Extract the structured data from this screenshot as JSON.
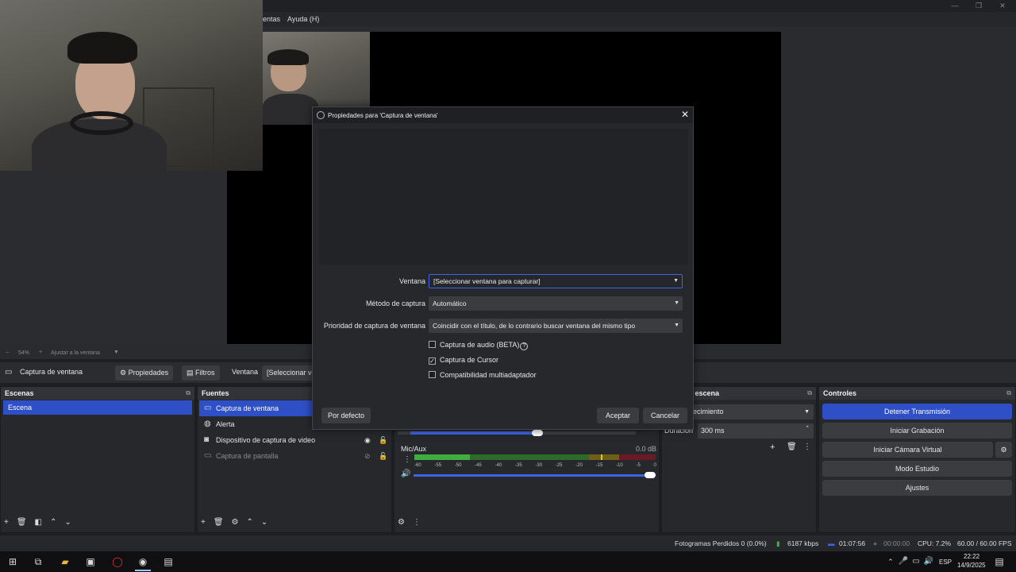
{
  "menu": {
    "partial_item": "entas",
    "help": "Ayuda (H)"
  },
  "zoom": {
    "minus": "−",
    "percent": "54%",
    "plus": "+",
    "fit": "Ajustar a la ventana"
  },
  "context_bar": {
    "source_name": "Captura de ventana",
    "properties": "Propiedades",
    "filters": "Filtros",
    "window_label": "Ventana",
    "window_value": "[Seleccionar ve"
  },
  "scenes": {
    "title": "Escenas",
    "items": [
      "Escena"
    ]
  },
  "sources": {
    "title": "Fuentes",
    "items": [
      {
        "name": "Captura de ventana",
        "icon": "window-icon",
        "selected": true
      },
      {
        "name": "Alerta",
        "icon": "globe-icon"
      },
      {
        "name": "Dispositivo de captura de video",
        "icon": "camera-icon"
      },
      {
        "name": "Captura de pantalla",
        "icon": "monitor-icon",
        "hidden": true
      }
    ]
  },
  "mixer": {
    "channel": "Mic/Aux",
    "level": "0.0 dB",
    "ticks": [
      "-60",
      "-55",
      "-50",
      "-45",
      "-40",
      "-35",
      "-30",
      "-25",
      "-20",
      "-15",
      "-10",
      "-5",
      "0"
    ]
  },
  "transitions": {
    "title": "ones de escena",
    "transition": "ecimiento",
    "duration_label": "Duración",
    "duration": "300 ms"
  },
  "controls": {
    "title": "Controles",
    "stop_stream": "Detener Transmisión",
    "start_recording": "Iniciar Grabación",
    "start_virtual_cam": "Iniciar Cámara Virtual",
    "studio_mode": "Modo Estudio",
    "settings": "Ajustes"
  },
  "status": {
    "dropped_frames": "Fotogramas Perdidos 0 (0.0%)",
    "bitrate": "6187 kbps",
    "stream_time": "01:07:56",
    "rec_time": "00:00:00",
    "cpu": "CPU: 7.2%",
    "fps": "60.00 / 60.00 FPS"
  },
  "dialog": {
    "title": "Propiedades para 'Captura de ventana'",
    "window_label": "Ventana",
    "window_value": "[Seleccionar ventana para capturar]",
    "method_label": "Método de captura",
    "method_value": "Automático",
    "priority_label": "Prioridad de captura de ventana",
    "priority_value": "Coincidir con el título, de lo contrario buscar ventana del mismo tipo",
    "audio_capture": "Captura de audio (BETA)",
    "audio_checked": false,
    "cursor_capture": "Captura de Cursor",
    "cursor_checked": true,
    "multiadapter": "Compatibilidad multiadaptador",
    "multiadapter_checked": false,
    "defaults": "Por defecto",
    "ok": "Aceptar",
    "cancel": "Cancelar"
  },
  "taskbar": {
    "language": "ESP",
    "time": "22:22",
    "date": "14/9/2025"
  },
  "colors": {
    "accent": "#2f4fc6",
    "meter_green": "#3fae3f",
    "meter_yellow": "#b89b1e",
    "meter_red": "#8c1f2c"
  }
}
